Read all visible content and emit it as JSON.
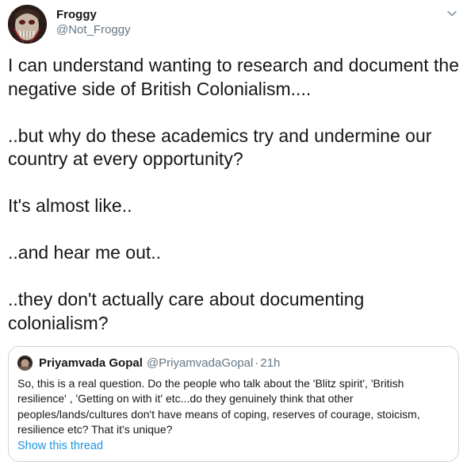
{
  "author": {
    "display_name": "Froggy",
    "handle": "@Not_Froggy",
    "avatar_icon": "avatar-image"
  },
  "menu_icon": "chevron-down-icon",
  "tweet_paragraphs": [
    "I can understand wanting to research and document the negative side of British Colonialism....",
    "..but why do these academics try and undermine our country at every opportunity?",
    "It's almost like..",
    "..and hear me out..",
    "..they don't actually care about documenting colonialism?"
  ],
  "quoted_tweet": {
    "display_name": "Priyamvada Gopal",
    "handle": "@PriyamvadaGopal",
    "separator": "·",
    "time": "21h",
    "text": "So, this is a real question. Do the people who talk about the 'Blitz spirit', 'British resilience' , 'Getting on with it' etc...do they genuinely think that other peoples/lands/cultures don't have means of coping, reserves of courage, stoicism, resilience etc? That it's unique?",
    "show_thread_label": "Show this thread"
  },
  "colors": {
    "text_primary": "#14171a",
    "text_secondary": "#657786",
    "link": "#1b95e0",
    "border": "#ccd6dd"
  }
}
